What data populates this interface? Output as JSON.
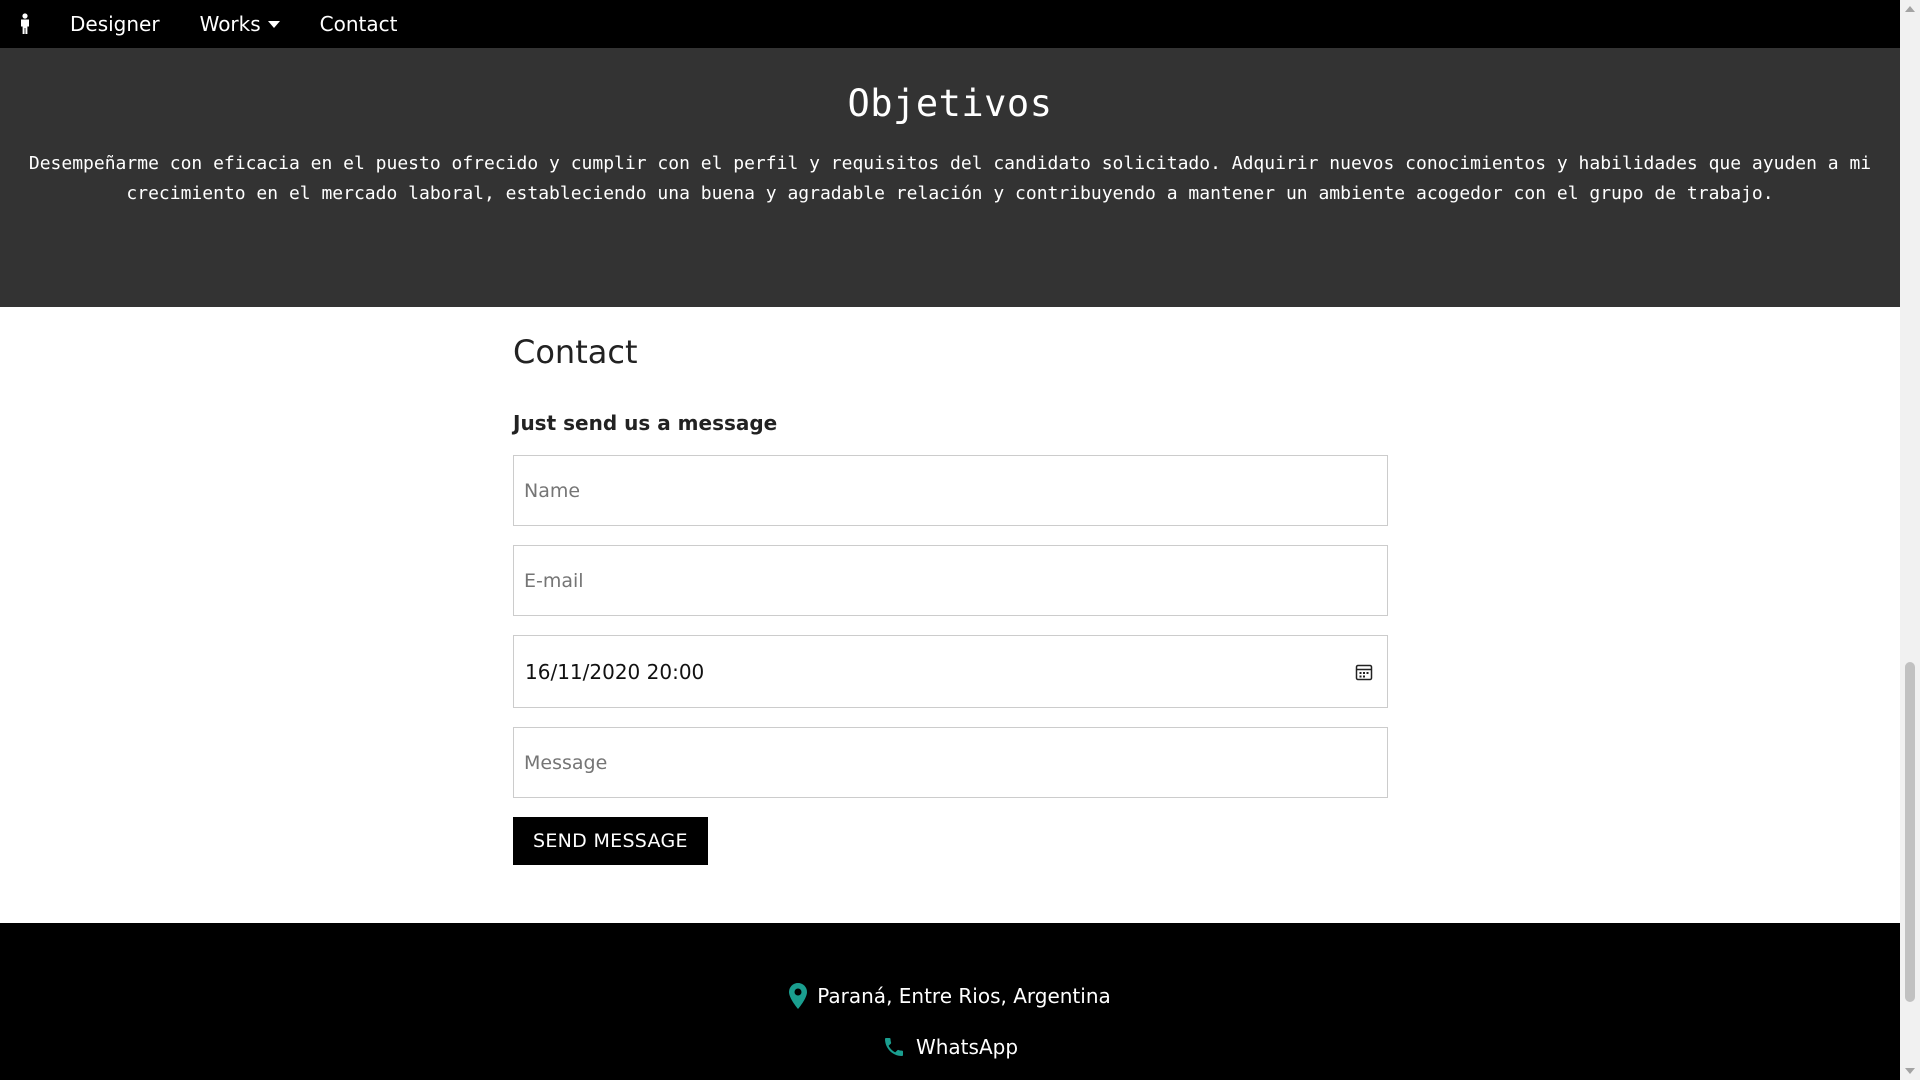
{
  "nav": {
    "logo_icon": "person-icon",
    "items": [
      {
        "label": "Designer"
      },
      {
        "label": "Works",
        "icon": "caret-down-icon"
      },
      {
        "label": "Contact"
      }
    ]
  },
  "objetivos": {
    "title": "Objetivos",
    "text": "Desempeñarme con eficacia en el puesto ofrecido y cumplir con el perfil y requisitos del candidato solicitado. Adquirir nuevos conocimientos y habilidades que ayuden a mi crecimiento en el mercado laboral, estableciendo una buena y agradable relación y contribuyendo a mantener un ambiente acogedor con el grupo de trabajo."
  },
  "contact": {
    "title": "Contact",
    "subtitle": "Just send us a message",
    "name_placeholder": "Name",
    "email_placeholder": "E-mail",
    "datetime_value": "16/11/2020 20:00",
    "message_placeholder": "Message",
    "send_label": "SEND MESSAGE"
  },
  "footer": {
    "location": "Paraná, Entre Rios, Argentina",
    "whatsapp": "WhatsApp",
    "icon_color": "#1a9e8f"
  },
  "colors": {
    "nav_bg": "#000000",
    "section_bg": "#333333",
    "footer_bg": "#000000",
    "button_bg": "#000000"
  }
}
